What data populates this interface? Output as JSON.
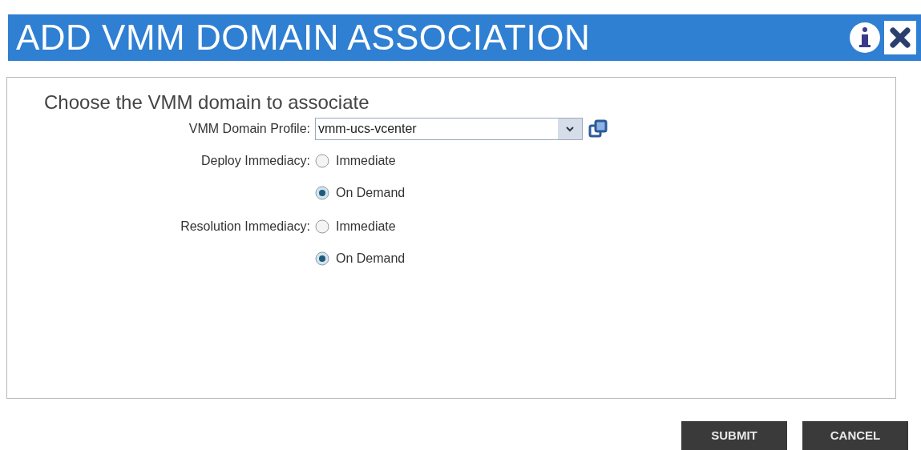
{
  "window": {
    "title": "ADD VMM DOMAIN ASSOCIATION"
  },
  "heading": "Choose the VMM domain to associate",
  "fields": [
    {
      "kind": "combo",
      "label": "VMM Domain Profile:",
      "value": "vmm-ucs-vcenter"
    },
    {
      "kind": "radio",
      "label": "Deploy Immediacy:",
      "options": [
        {
          "label": "Immediate",
          "selected": false
        },
        {
          "label": "On Demand",
          "selected": true
        }
      ]
    },
    {
      "kind": "radio",
      "label": "Resolution Immediacy:",
      "options": [
        {
          "label": "Immediate",
          "selected": false
        },
        {
          "label": "On Demand",
          "selected": true
        }
      ]
    }
  ],
  "buttons": [
    "SUBMIT",
    "CANCEL"
  ]
}
